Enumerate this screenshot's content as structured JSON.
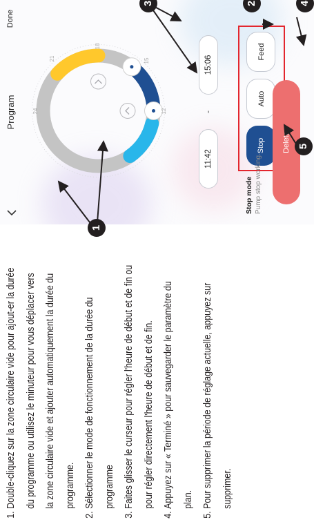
{
  "instructions": [
    {
      "num": "1.",
      "text": "Double-cliquez sur la zone circulaire vide pour ajout-er la durée du programme ou utilisez le minuteur pour vous déplacer vers la zone circulaire vide et ajouter automatiquement la durée du programme."
    },
    {
      "num": "2.",
      "text": "Sélectionner le mode de fonctionnement de la durée du programme"
    },
    {
      "num": "3.",
      "text": "Faites glisser le curseur pour régler l'heure de début et de fin ou pour régler directement l'heure de début et de fin."
    },
    {
      "num": "4.",
      "text": "Appuyez sur « Terminé » pour sauvegarder le paramètre du plan."
    },
    {
      "num": "5.",
      "text": "Pour supprimer la période de réglage actuelle, appuyez sur supprimer."
    }
  ],
  "app": {
    "title": "Program",
    "done_label": "Done",
    "back_icon": "chevron-left-icon",
    "dial_labels": [
      "24",
      "21",
      "18",
      "15",
      "12"
    ],
    "start_time": "11:42",
    "separator": "-",
    "end_time": "15:06",
    "modes": [
      {
        "label": "Stop",
        "selected": true
      },
      {
        "label": "Auto",
        "selected": false
      },
      {
        "label": "Feed",
        "selected": false
      }
    ],
    "mode_title": "Stop mode",
    "mode_desc": "Pump stop working.",
    "delete_label": "Delete",
    "colors": {
      "selected": "#1f4f92",
      "delete": "#ed6f6f",
      "ring": "#c4c4c4",
      "yellow": "#ffc82c",
      "cyan": "#29b6ea",
      "navy": "#1f4f92",
      "highlight_box": "#e3262e"
    }
  },
  "callouts": [
    "1",
    "2",
    "3",
    "4",
    "5"
  ]
}
